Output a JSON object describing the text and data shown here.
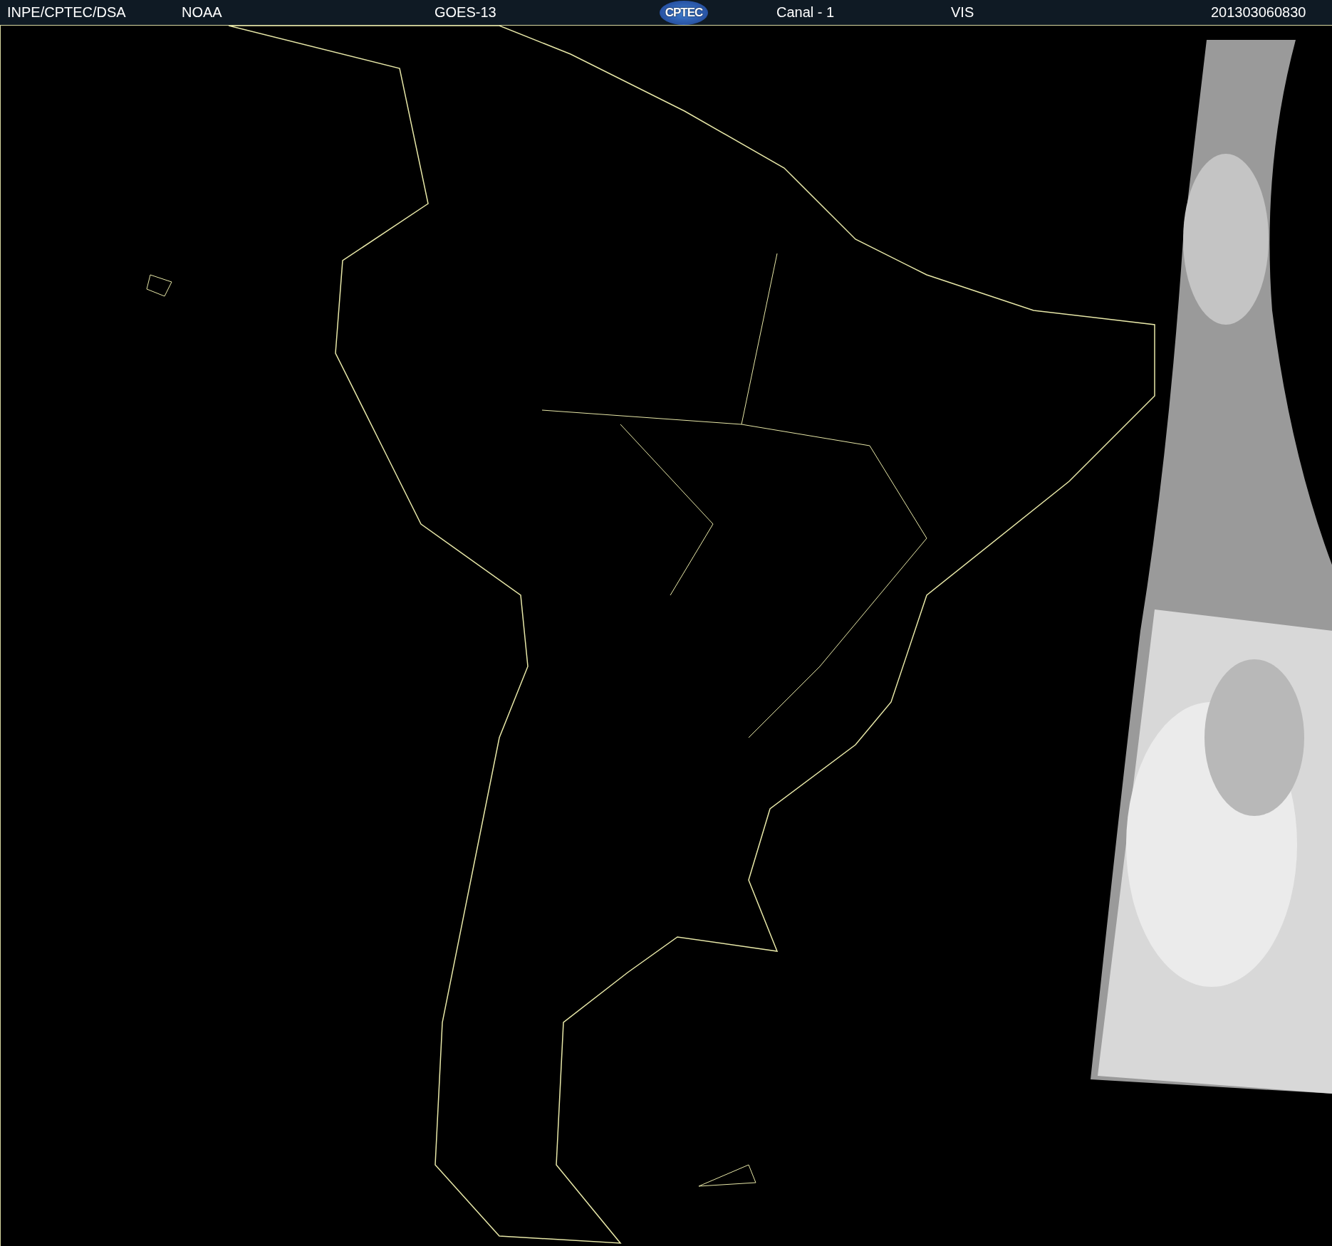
{
  "header": {
    "source": "INPE/CPTEC/DSA",
    "agency": "NOAA",
    "satellite": "GOES-13",
    "logo": "CPTEC",
    "channel": "Canal - 1",
    "band": "VIS",
    "timestamp": "201303060830"
  }
}
